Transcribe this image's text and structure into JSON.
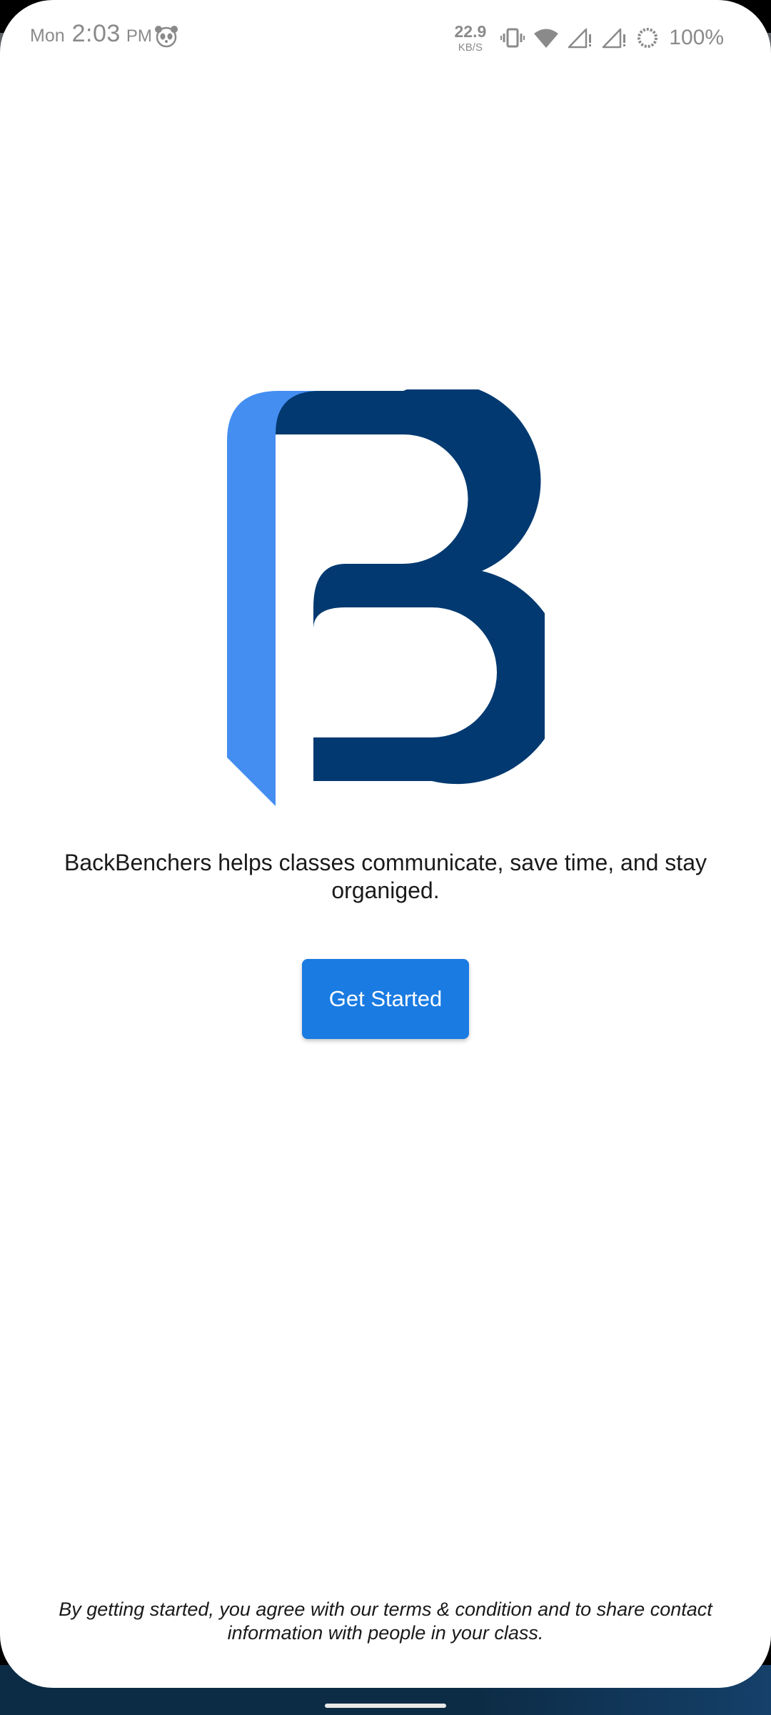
{
  "status_bar": {
    "day": "Mon",
    "time": "2:03",
    "ampm": "PM",
    "net_speed": "22.9",
    "net_unit": "KB/S",
    "battery": "100%",
    "icons": [
      "panda-icon",
      "vibrate-icon",
      "wifi-icon",
      "signal-1-icon",
      "signal-2-icon",
      "battery-saver-icon"
    ]
  },
  "brand": {
    "logo_icon": "backbenchers-b-logo",
    "logo_light_color": "#448ef1",
    "logo_dark_color": "#013970"
  },
  "welcome": {
    "tagline": "BackBenchers helps classes communicate, save time, and stay organiged.",
    "cta_label": "Get Started",
    "cta_color": "#1a7be2",
    "disclaimer": "By getting started, you agree with our terms & condition and to share contact information with people in your class."
  }
}
